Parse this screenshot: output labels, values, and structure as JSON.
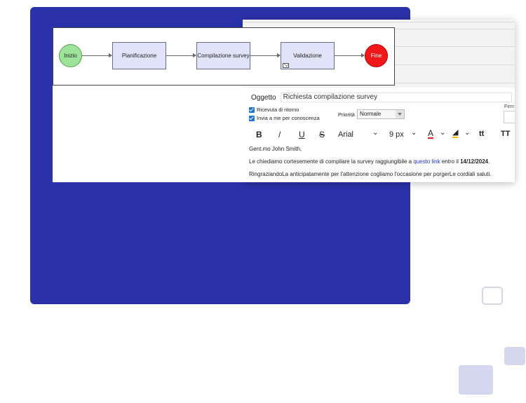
{
  "workflow": {
    "start": "Inizio",
    "steps": [
      "Pianificazione",
      "Compilazione survey",
      "Validazione"
    ],
    "end": "Fine"
  },
  "email": {
    "subject_label": "Oggetto",
    "subject_value": "Richiesta compilazione survey",
    "checkbox_return_receipt": "Ricevuta di ritorno",
    "checkbox_cc_me": "Invia a me per conoscenza",
    "priority_label": "Priorità",
    "priority_value": "Normale",
    "signature_label": "Firm",
    "toolbar": {
      "bold": "B",
      "italic": "/",
      "underline": "U",
      "strike": "S",
      "font": "Arial",
      "size": "9 px",
      "text_color": "A",
      "superscript": "tt",
      "text_transform": "TT"
    },
    "body": {
      "greeting": "Gent.mo John Smith,",
      "line1_before": "Le chiediamo cortesemente di compilare la survey raggiungibile a ",
      "line1_link": "questo link",
      "line1_mid": " entro il ",
      "line1_date": "14/12/2024",
      "line1_end": ".",
      "closing": "RingraziandoLa anticipatamente per l'attenzione cogliamo l'occasione per porgerLe cordiali saluti."
    }
  },
  "colors": {
    "panel": "#2b31a8",
    "start_node": "#9de39a",
    "end_node": "#f01818",
    "task_node": "#e1e3fb",
    "link": "#1a2fd0",
    "decor": "#d4d7ef"
  }
}
